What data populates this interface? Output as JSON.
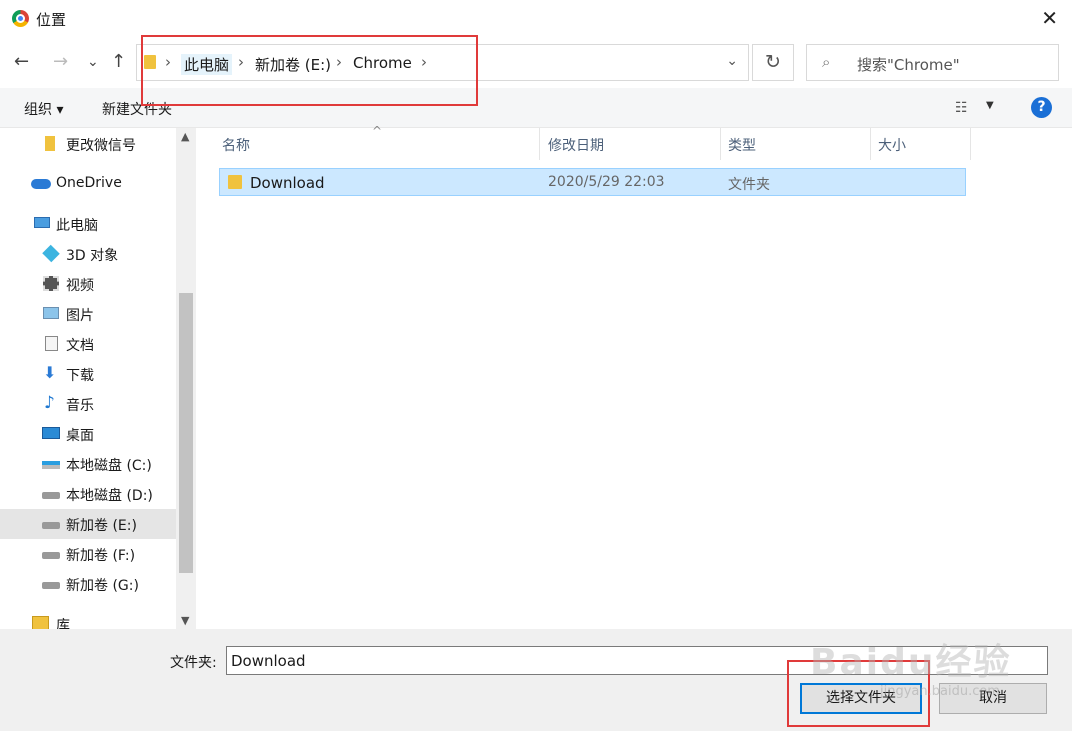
{
  "window": {
    "title": "位置",
    "close_label": "✕"
  },
  "nav": {
    "back": "←",
    "forward": "→",
    "recent": "⌄",
    "up": "↑",
    "breadcrumb": [
      "此电脑",
      "新加卷 (E:)",
      "Chrome"
    ],
    "sep": "›",
    "dropdown": "⌄",
    "refresh": "↻",
    "search_icon": "⌕",
    "search_placeholder": "搜索\"Chrome\""
  },
  "toolbar": {
    "organize": "组织 ▾",
    "new_folder": "新建文件夹",
    "view_icon": "☷",
    "view_dropdown": "▼",
    "help": "?"
  },
  "sidebar": {
    "items": [
      {
        "label": "更改微信号",
        "icon": "folder-icon"
      },
      {
        "label": "OneDrive",
        "icon": "cloud-icon"
      },
      {
        "label": "此电脑",
        "icon": "computer-icon"
      },
      {
        "label": "3D 对象",
        "icon": "cube-icon"
      },
      {
        "label": "视频",
        "icon": "film-icon"
      },
      {
        "label": "图片",
        "icon": "picture-icon"
      },
      {
        "label": "文档",
        "icon": "document-icon"
      },
      {
        "label": "下载",
        "icon": "download-icon"
      },
      {
        "label": "音乐",
        "icon": "music-icon"
      },
      {
        "label": "桌面",
        "icon": "desktop-icon"
      },
      {
        "label": "本地磁盘 (C:)",
        "icon": "windows-drive-icon"
      },
      {
        "label": "本地磁盘 (D:)",
        "icon": "drive-icon"
      },
      {
        "label": "新加卷 (E:)",
        "icon": "drive-icon"
      },
      {
        "label": "新加卷 (F:)",
        "icon": "drive-icon"
      },
      {
        "label": "新加卷 (G:)",
        "icon": "drive-icon"
      },
      {
        "label": "库",
        "icon": "library-icon"
      }
    ],
    "selected": "新加卷 (E:)",
    "scroll_up": "▲",
    "scroll_down": "▼"
  },
  "content": {
    "columns": [
      "名称",
      "修改日期",
      "类型",
      "大小"
    ],
    "sort_caret": "^",
    "rows": [
      {
        "name": "Download",
        "date": "2020/5/29 22:03",
        "type": "文件夹",
        "size": ""
      }
    ]
  },
  "footer": {
    "folder_label": "文件夹:",
    "folder_value": "Download",
    "select_button": "选择文件夹",
    "cancel_button": "取消"
  },
  "watermark": {
    "text": "Baidu经验",
    "url": "jingyan.baidu.com"
  },
  "colors": {
    "accent": "#0078d7",
    "selection": "#cce8ff",
    "annotation": "#e03a3a"
  }
}
